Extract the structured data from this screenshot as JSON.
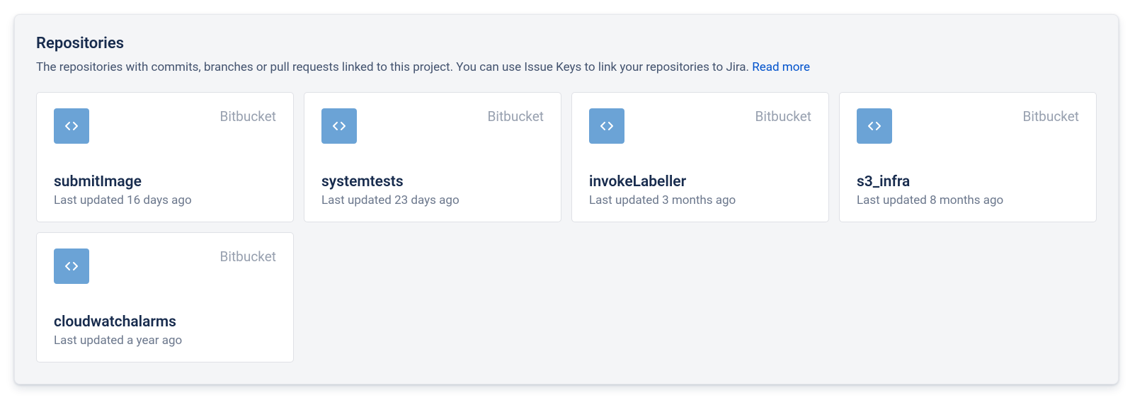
{
  "header": {
    "title": "Repositories",
    "description": "The repositories with commits, branches or pull requests linked to this project. You can use Issue Keys to link your repositories to Jira. ",
    "read_more": "Read more"
  },
  "repositories": [
    {
      "provider": "Bitbucket",
      "name": "submitImage",
      "updated": "Last updated 16 days ago"
    },
    {
      "provider": "Bitbucket",
      "name": "systemtests",
      "updated": "Last updated 23 days ago"
    },
    {
      "provider": "Bitbucket",
      "name": "invokeLabeller",
      "updated": "Last updated 3 months ago"
    },
    {
      "provider": "Bitbucket",
      "name": "s3_infra",
      "updated": "Last updated 8 months ago"
    },
    {
      "provider": "Bitbucket",
      "name": "cloudwatchalarms",
      "updated": "Last updated a year ago"
    }
  ]
}
